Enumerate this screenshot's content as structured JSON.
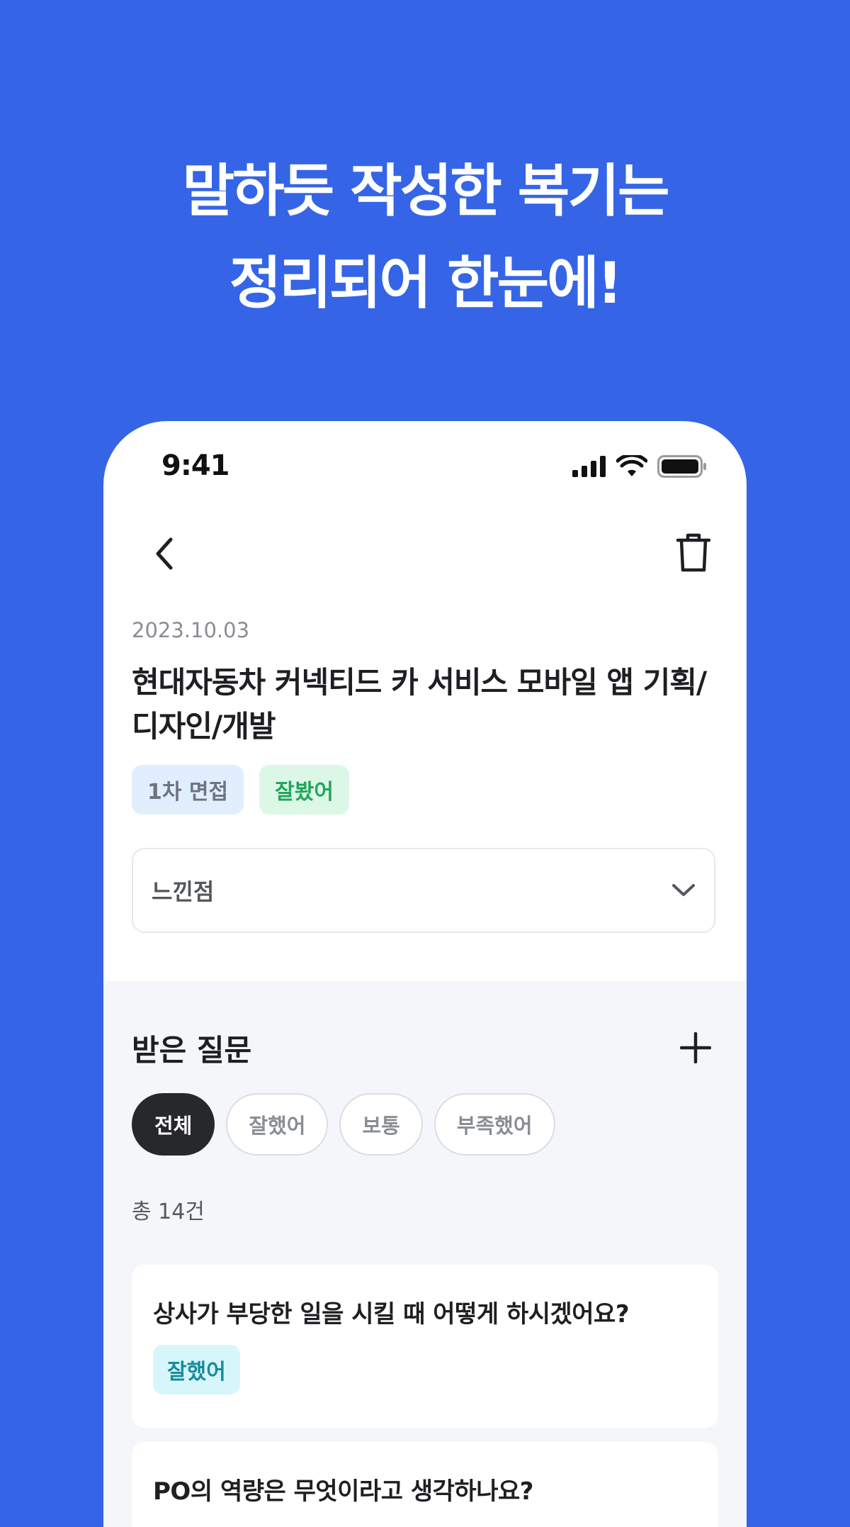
{
  "headline": {
    "line1": "말하듯 작성한 복기는",
    "line2": "정리되어 한눈에!"
  },
  "status_bar": {
    "time": "9:41",
    "icons": [
      "signal-icon",
      "wifi-icon",
      "battery-icon"
    ]
  },
  "nav": {
    "back_icon": "chevron-left-icon",
    "delete_icon": "trash-icon"
  },
  "review": {
    "date": "2023.10.03",
    "title": "현대자동차 커넥티드 카 서비스 모바일 앱 기획/디자인/개발",
    "tags": [
      {
        "label": "1차 면접"
      },
      {
        "label": "잘봤어"
      }
    ],
    "accordion_label": "느낀점"
  },
  "questions": {
    "section_title": "받은 질문",
    "filters": [
      {
        "label": "전체",
        "active": true
      },
      {
        "label": "잘했어",
        "active": false
      },
      {
        "label": "보통",
        "active": false
      },
      {
        "label": "부족했어",
        "active": false
      }
    ],
    "count_text": "총 14건",
    "items": [
      {
        "text": "상사가 부당한 일을 시킬 때 어떻게 하시겠어요?",
        "badge": "잘했어"
      },
      {
        "text": "PO의 역량은 무엇이라고 생각하나요?"
      }
    ]
  },
  "colors": {
    "background": "#3565E6",
    "round_tag_bg": "#E1EEFD",
    "result_tag_bg": "#DDF7E7",
    "result_tag_text": "#22A55A",
    "question_badge_bg": "#D7F6FA",
    "question_badge_text": "#178B9A",
    "active_chip": "#27282B"
  }
}
